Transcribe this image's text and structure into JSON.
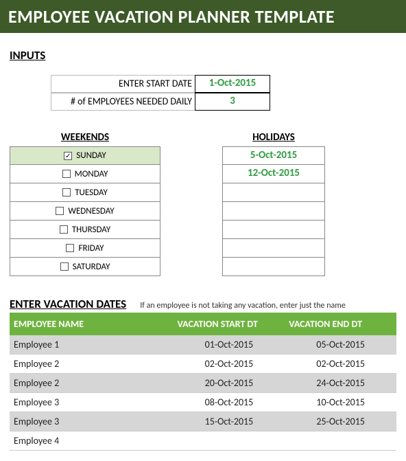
{
  "header": {
    "title": "EMPLOYEE VACATION PLANNER TEMPLATE"
  },
  "inputs": {
    "section_title": "INPUTS",
    "start_date_label": "ENTER START DATE",
    "start_date_value": "1-Oct-2015",
    "emp_needed_label": "# of EMPLOYEES NEEDED DAILY",
    "emp_needed_value": "3"
  },
  "weekends": {
    "header": "WEEKENDS",
    "days": [
      {
        "label": "SUNDAY",
        "checked": true
      },
      {
        "label": "MONDAY",
        "checked": false
      },
      {
        "label": "TUESDAY",
        "checked": false
      },
      {
        "label": "WEDNESDAY",
        "checked": false
      },
      {
        "label": "THURSDAY",
        "checked": false
      },
      {
        "label": "FRIDAY",
        "checked": false
      },
      {
        "label": "SATURDAY",
        "checked": false
      }
    ]
  },
  "holidays": {
    "header": "HOLIDAYS",
    "dates": [
      "5-Oct-2015",
      "12-Oct-2015",
      "",
      "",
      "",
      "",
      ""
    ]
  },
  "vacation": {
    "section_title": "ENTER VACATION DATES",
    "helper": "If an employee is not taking any vacation, enter just the name",
    "columns": {
      "name": "EMPLOYEE NAME",
      "start": "VACATION START DT",
      "end": "VACATION END DT"
    },
    "rows": [
      {
        "name": "Employee 1",
        "start": "01-Oct-2015",
        "end": "05-Oct-2015"
      },
      {
        "name": "Employee 2",
        "start": "02-Oct-2015",
        "end": "02-Oct-2015"
      },
      {
        "name": "Employee 2",
        "start": "20-Oct-2015",
        "end": "24-Oct-2015"
      },
      {
        "name": "Employee 3",
        "start": "08-Oct-2015",
        "end": "10-Oct-2015"
      },
      {
        "name": "Employee 3",
        "start": "15-Oct-2015",
        "end": "25-Oct-2015"
      },
      {
        "name": "Employee 4",
        "start": "",
        "end": ""
      }
    ]
  }
}
